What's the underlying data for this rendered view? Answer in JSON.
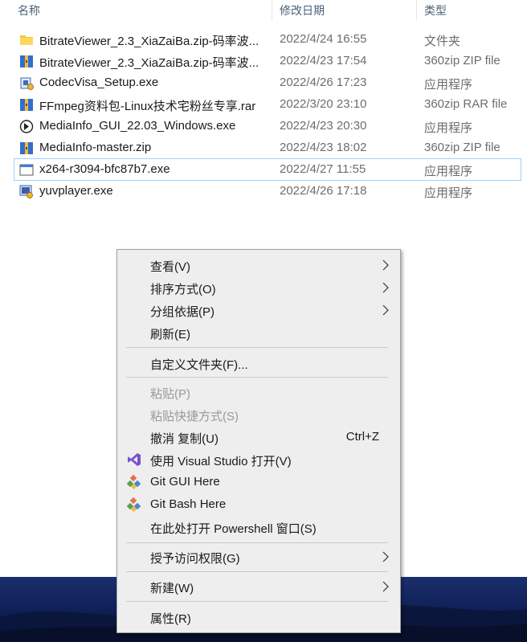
{
  "columns": {
    "name": "名称",
    "modified": "修改日期",
    "type": "类型"
  },
  "files": [
    {
      "name": "BitrateViewer_2.3_XiaZaiBa.zip-码率波...",
      "date": "2022/4/24 16:55",
      "type": "文件夹",
      "icon": "folder-icon"
    },
    {
      "name": "BitrateViewer_2.3_XiaZaiBa.zip-码率波...",
      "date": "2022/4/23 17:54",
      "type": "360zip ZIP file",
      "icon": "zip-archive-icon"
    },
    {
      "name": "CodecVisa_Setup.exe",
      "date": "2022/4/26 17:23",
      "type": "应用程序",
      "icon": "installer-icon"
    },
    {
      "name": "FFmpeg资料包-Linux技术宅粉丝专享.rar",
      "date": "2022/3/20 23:10",
      "type": "360zip RAR file",
      "icon": "rar-archive-icon"
    },
    {
      "name": "MediaInfo_GUI_22.03_Windows.exe",
      "date": "2022/4/23 20:30",
      "type": "应用程序",
      "icon": "mediainfo-icon"
    },
    {
      "name": "MediaInfo-master.zip",
      "date": "2022/4/23 18:02",
      "type": "360zip ZIP file",
      "icon": "zip-archive-icon"
    },
    {
      "name": "x264-r3094-bfc87b7.exe",
      "date": "2022/4/27 11:55",
      "type": "应用程序",
      "icon": "window-app-icon"
    },
    {
      "name": "yuvplayer.exe",
      "date": "2022/4/26 17:18",
      "type": "应用程序",
      "icon": "yuvplayer-icon"
    }
  ],
  "menu": {
    "view": "查看(V)",
    "sort": "排序方式(O)",
    "group": "分组依据(P)",
    "refresh": "刷新(E)",
    "customize": "自定义文件夹(F)...",
    "paste": "粘贴(P)",
    "paste_shortcut": "粘贴快捷方式(S)",
    "undo": "撤消 复制(U)",
    "undo_shortcut": "Ctrl+Z",
    "open_vs": "使用 Visual Studio 打开(V)",
    "git_gui": "Git GUI Here",
    "git_bash": "Git Bash Here",
    "powershell": "在此处打开 Powershell 窗口(S)",
    "grant_access": "授予访问权限(G)",
    "new": "新建(W)",
    "properties": "属性(R)"
  },
  "colors": {
    "menu_bg": "#eeeeee",
    "selection_outline": "#99d1ff",
    "header_text": "#4c607a",
    "wallpaper": "#12245e"
  }
}
